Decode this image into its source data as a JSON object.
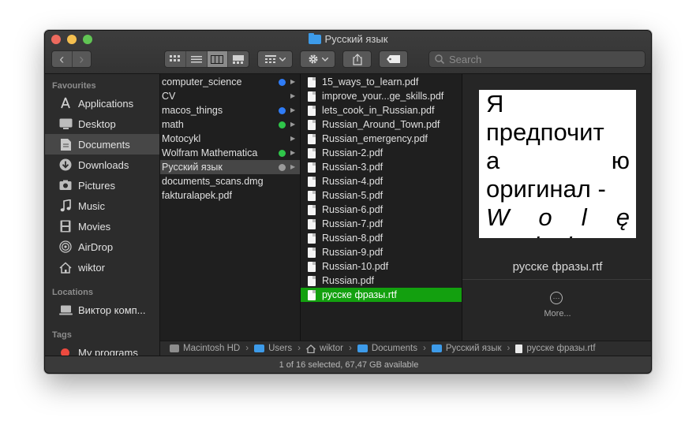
{
  "window": {
    "title": "Русский язык"
  },
  "toolbar": {
    "back_glyph": "‹",
    "forward_glyph": "›",
    "search_placeholder": "Search",
    "icons": [
      "back-icon",
      "forward-icon",
      "icon-view-icon",
      "list-view-icon",
      "column-view-icon",
      "gallery-view-icon",
      "group-icon",
      "gear-icon",
      "share-icon",
      "tag-icon",
      "search-icon"
    ]
  },
  "sidebar": {
    "favourites_header": "Favourites",
    "favourites": [
      {
        "label": "Applications",
        "icon": "applications-icon"
      },
      {
        "label": "Desktop",
        "icon": "desktop-icon"
      },
      {
        "label": "Documents",
        "icon": "documents-icon",
        "selected": true
      },
      {
        "label": "Downloads",
        "icon": "downloads-icon"
      },
      {
        "label": "Pictures",
        "icon": "pictures-icon"
      },
      {
        "label": "Music",
        "icon": "music-icon"
      },
      {
        "label": "Movies",
        "icon": "movies-icon"
      },
      {
        "label": "AirDrop",
        "icon": "airdrop-icon"
      },
      {
        "label": "wiktor",
        "icon": "home-icon"
      }
    ],
    "locations_header": "Locations",
    "locations": [
      {
        "label": "Виктор комп...",
        "icon": "computer-icon"
      }
    ],
    "tags_header": "Tags",
    "tags": [
      {
        "label": "My programs",
        "color": "#ec4a3f"
      }
    ]
  },
  "column1": [
    {
      "name": "computer_science",
      "tag": "#2f7cf6",
      "arrow": true
    },
    {
      "name": "CV",
      "arrow": true
    },
    {
      "name": "macos_things",
      "tag": "#2f7cf6",
      "arrow": true
    },
    {
      "name": "math",
      "tag": "#2fc54a",
      "arrow": true
    },
    {
      "name": "Motocykl",
      "arrow": true
    },
    {
      "name": "Wolfram Mathematica",
      "tag": "#2fc54a",
      "arrow": true
    },
    {
      "name": "Русский язык",
      "tag": "#9a9a9a",
      "arrow": true,
      "selected": true
    },
    {
      "name": "documents_scans.dmg"
    },
    {
      "name": "fakturalapek.pdf"
    }
  ],
  "column2": [
    {
      "name": "15_ways_to_learn.pdf"
    },
    {
      "name": "improve_your...ge_skills.pdf"
    },
    {
      "name": "lets_cook_in_Russian.pdf"
    },
    {
      "name": "Russian_Around_Town.pdf"
    },
    {
      "name": "Russian_emergency.pdf"
    },
    {
      "name": "Russian-2.pdf"
    },
    {
      "name": "Russian-3.pdf"
    },
    {
      "name": "Russian-4.pdf"
    },
    {
      "name": "Russian-5.pdf"
    },
    {
      "name": "Russian-6.pdf"
    },
    {
      "name": "Russian-7.pdf"
    },
    {
      "name": "Russian-8.pdf"
    },
    {
      "name": "Russian-9.pdf"
    },
    {
      "name": "Russian-10.pdf"
    },
    {
      "name": "Russian.pdf"
    },
    {
      "name": "русске фразы.rtf",
      "selected": true
    }
  ],
  "preview": {
    "doc_lines": [
      "Я",
      "предпочит",
      "а",
      "ю",
      "оригинал -",
      "W",
      "o",
      "l",
      "ę",
      "oryginał"
    ],
    "file_name": "русске фразы.rtf",
    "more_glyph": "···",
    "more_label": "More..."
  },
  "pathbar": {
    "separator": "›",
    "items": [
      {
        "label": "Macintosh HD",
        "icon": "hard-drive-icon"
      },
      {
        "label": "Users",
        "icon": "folder-icon"
      },
      {
        "label": "wiktor",
        "icon": "home-icon"
      },
      {
        "label": "Documents",
        "icon": "folder-icon"
      },
      {
        "label": "Русский язык",
        "icon": "folder-icon"
      },
      {
        "label": "русске фразы.rtf",
        "icon": "file-icon"
      }
    ]
  },
  "status": {
    "text": "1 of 16 selected, 67,47 GB available"
  },
  "colors": {
    "selection_green": "#13a00f",
    "folder_blue": "#3d9be9",
    "window_bg": "#262626"
  }
}
